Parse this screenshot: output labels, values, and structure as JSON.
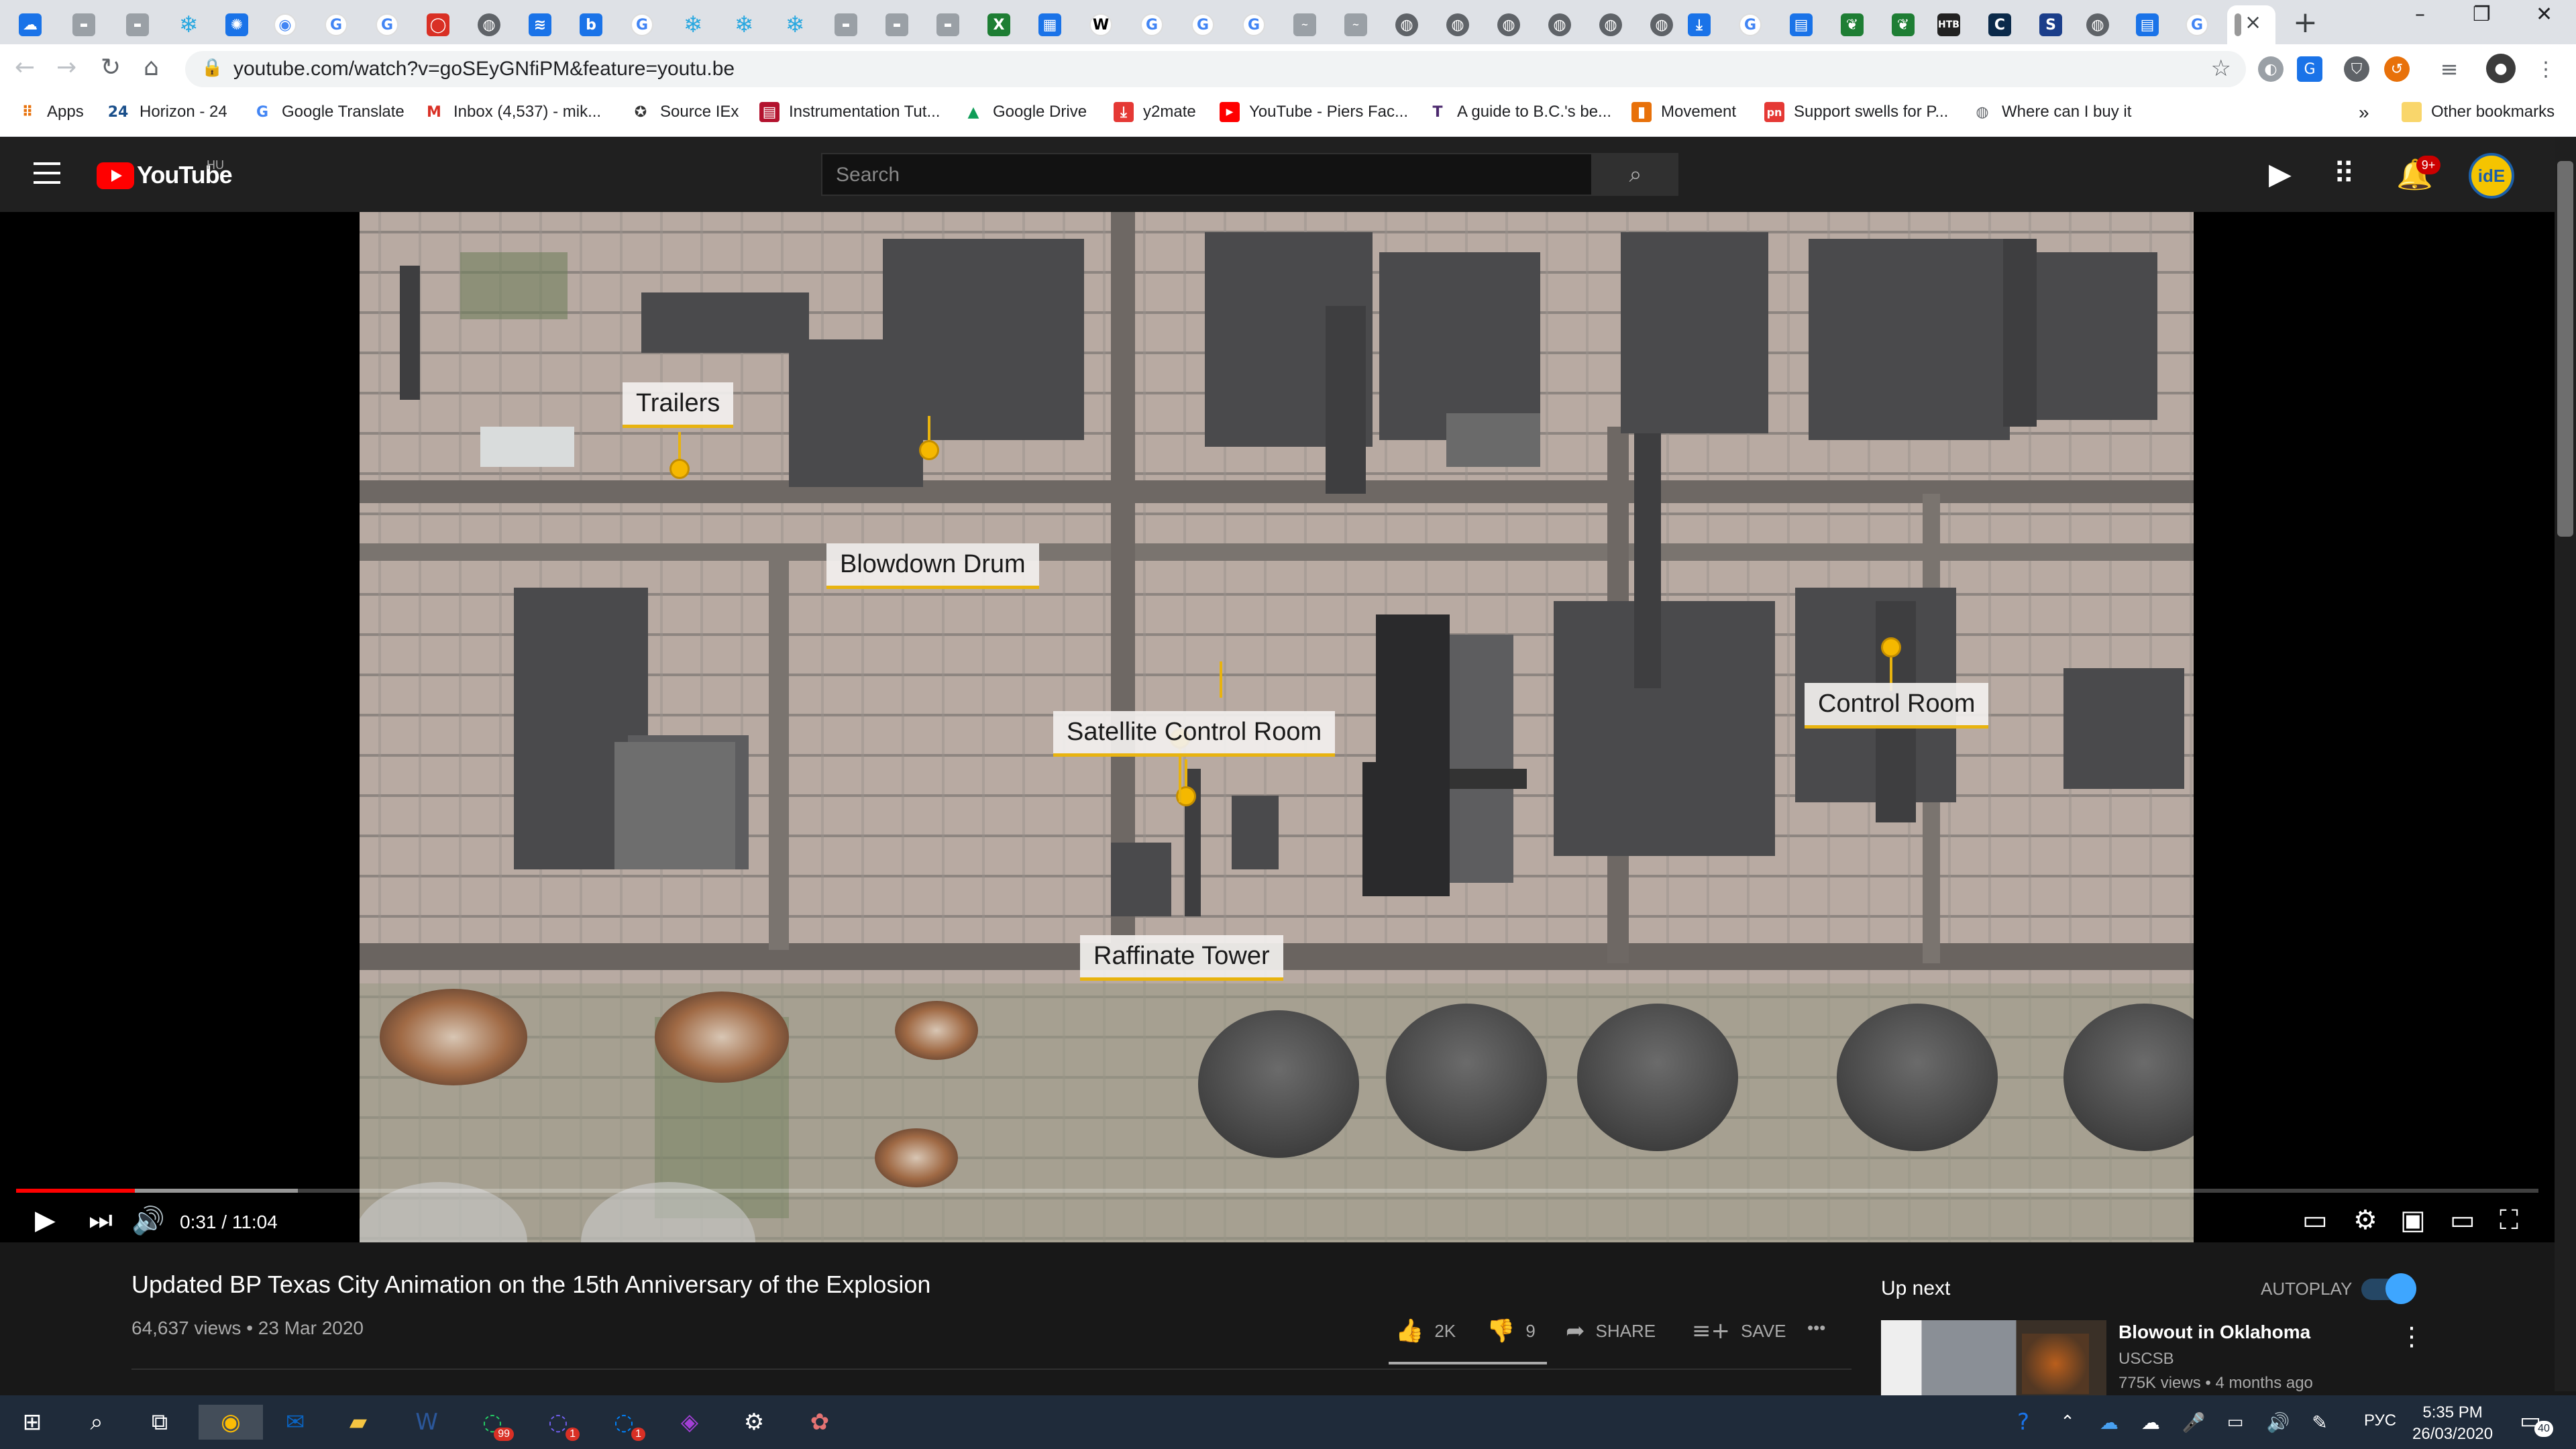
{
  "browser": {
    "active_tab_close": "×",
    "new_tab": "+",
    "window_controls": {
      "minimize": "–",
      "restore": "❐",
      "close": "✕"
    },
    "tab_favicons": [
      "cloud",
      "bsx",
      "bsx",
      "snowflake",
      "pinwheel",
      "chrome",
      "google",
      "google",
      "red-chat",
      "globe",
      "rss",
      "box",
      "google",
      "snowflake",
      "snowflake",
      "snowflake",
      "bsx",
      "bsx",
      "bsx",
      "excel",
      "dark-box",
      "wikipedia",
      "google",
      "google",
      "google",
      "gray",
      "gray",
      "globe",
      "globe",
      "globe",
      "globe",
      "globe",
      "globe",
      "download",
      "google",
      "table",
      "green-leaf",
      "green-leaf",
      "htb",
      "blue-dark",
      "skype",
      "globe",
      "table",
      "google",
      "active"
    ],
    "address": {
      "url": "youtube.com/watch?v=goSEyGNfiPM&feature=youtu.be"
    },
    "bookmarks": [
      {
        "label": "Apps",
        "icon": "apps-grid-icon"
      },
      {
        "label": "Horizon - 24",
        "icon": "24-icon"
      },
      {
        "label": "Google Translate",
        "icon": "google-icon"
      },
      {
        "label": "Inbox (4,537) - mik...",
        "icon": "gmail-icon"
      },
      {
        "label": "Source IEx",
        "icon": "source-icon"
      },
      {
        "label": "Instrumentation Tut...",
        "icon": "instrumentation-icon"
      },
      {
        "label": "Google Drive",
        "icon": "drive-icon"
      },
      {
        "label": "y2mate",
        "icon": "y2mate-icon"
      },
      {
        "label": "YouTube - Piers Fac...",
        "icon": "youtube-icon"
      },
      {
        "label": "A guide to B.C.'s be...",
        "icon": "telus-icon"
      },
      {
        "label": "Movement",
        "icon": "movement-icon"
      },
      {
        "label": "Support swells for P...",
        "icon": "pn-icon"
      },
      {
        "label": "Where can I buy it",
        "icon": "globe-icon"
      }
    ],
    "bookmarks_overflow": "»",
    "other_bookmarks": "Other bookmarks"
  },
  "youtube": {
    "logo_text": "YouTube",
    "country": "HU",
    "search_placeholder": "Search",
    "notifications_badge": "9+",
    "avatar_text": "idE",
    "video": {
      "labels": {
        "trailers": "Trailers",
        "blowdown": "Blowdown Drum",
        "satellite": "Satellite Control Room",
        "control": "Control Room",
        "raffinate": "Raffinate Tower"
      },
      "time": "0:31 / 11:04",
      "progress_fraction": 0.047
    },
    "title": "Updated BP Texas City Animation on the 15th Anniversary of the Explosion",
    "meta": "64,637 views • 23 Mar 2020",
    "actions": {
      "likes": "2K",
      "dislikes": "9",
      "share": "SHARE",
      "save": "SAVE",
      "more": "•••"
    },
    "up_next": {
      "heading": "Up next",
      "autoplay": "AUTOPLAY",
      "title": "Blowout in Oklahoma",
      "channel": "USCSB",
      "meta": "775K views • 4 months ago"
    }
  },
  "taskbar": {
    "whatsapp_badge": "99",
    "viber_badge": "1",
    "messenger_badge": "1",
    "lang": "РУС",
    "time": "5:35 PM",
    "date": "26/03/2020",
    "notification_count": "40"
  }
}
